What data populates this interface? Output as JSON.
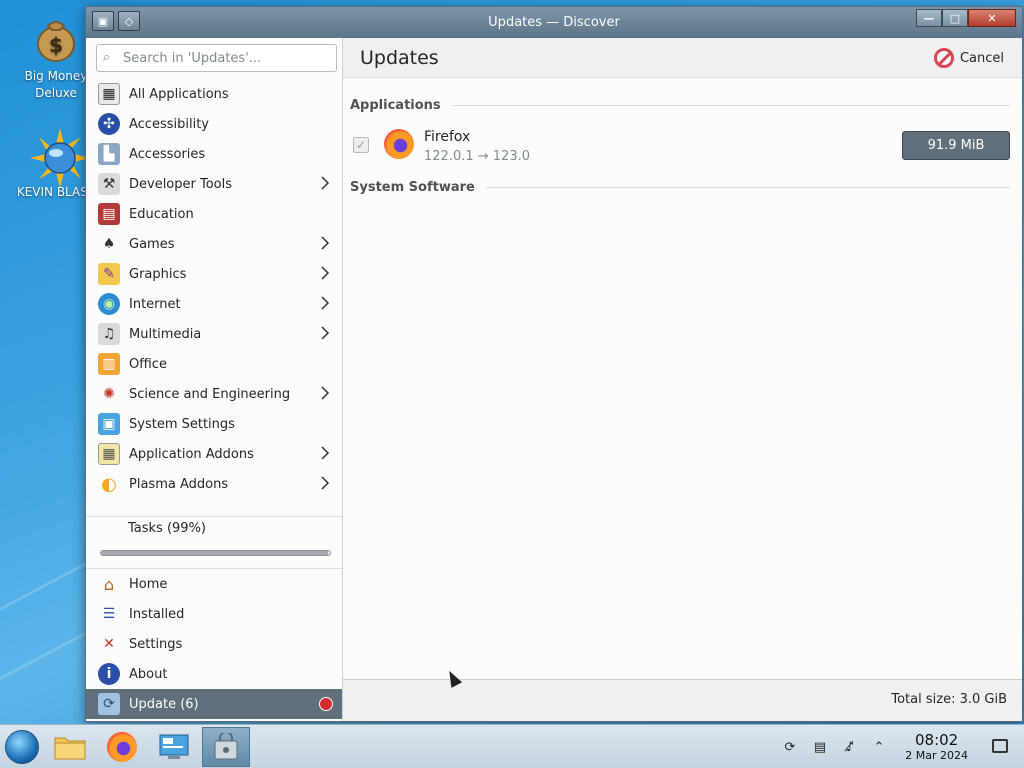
{
  "desktop": {
    "icons": [
      {
        "label": "Big Money\nDeluxe",
        "icon": "money-bag-icon"
      },
      {
        "label": "KEVIN BLAST",
        "icon": "sun-globe-icon"
      }
    ]
  },
  "window": {
    "title": "Updates — Discover"
  },
  "sidebar": {
    "search_placeholder": "Search in 'Updates'...",
    "categories": [
      {
        "label": "All Applications",
        "icon": "all-apps-icon",
        "has_children": false
      },
      {
        "label": "Accessibility",
        "icon": "accessibility-icon",
        "has_children": false
      },
      {
        "label": "Accessories",
        "icon": "accessories-icon",
        "has_children": false
      },
      {
        "label": "Developer Tools",
        "icon": "developer-tools-icon",
        "has_children": true
      },
      {
        "label": "Education",
        "icon": "education-icon",
        "has_children": false
      },
      {
        "label": "Games",
        "icon": "games-icon",
        "has_children": true
      },
      {
        "label": "Graphics",
        "icon": "graphics-icon",
        "has_children": true
      },
      {
        "label": "Internet",
        "icon": "internet-icon",
        "has_children": true
      },
      {
        "label": "Multimedia",
        "icon": "multimedia-icon",
        "has_children": true
      },
      {
        "label": "Office",
        "icon": "office-icon",
        "has_children": false
      },
      {
        "label": "Science and Engineering",
        "icon": "science-icon",
        "has_children": true
      },
      {
        "label": "System Settings",
        "icon": "system-settings-icon",
        "has_children": false
      },
      {
        "label": "Application Addons",
        "icon": "application-addons-icon",
        "has_children": true
      },
      {
        "label": "Plasma Addons",
        "icon": "plasma-addons-icon",
        "has_children": true
      }
    ],
    "tasks_label": "Tasks (99%)",
    "tasks_progress": 0.99,
    "nav": [
      {
        "label": "Home",
        "icon": "home-icon"
      },
      {
        "label": "Installed",
        "icon": "installed-icon"
      },
      {
        "label": "Settings",
        "icon": "settings-icon"
      },
      {
        "label": "About",
        "icon": "about-icon"
      },
      {
        "label": "Update (6)",
        "icon": "update-icon",
        "active": true
      }
    ]
  },
  "main": {
    "title": "Updates",
    "cancel_label": "Cancel",
    "sections": {
      "applications": "Applications",
      "system_software": "System Software"
    },
    "update_item": {
      "name": "Firefox",
      "version": "122.0.1 → 123.0",
      "size": "91.9 MiB",
      "checked": true
    },
    "total_size": "Total size: 3.0 GiB"
  },
  "taskbar": {
    "time": "08:02",
    "date": "2 Mar 2024"
  },
  "colors": {
    "accent": "#5f6f7c",
    "cancel_red": "#da4453",
    "desktop_blue": "#2f8fd0"
  }
}
